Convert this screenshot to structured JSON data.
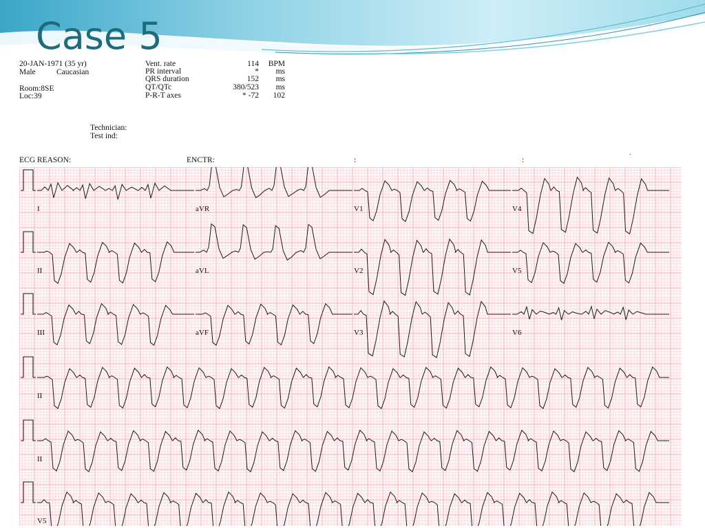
{
  "slide": {
    "title": "Case 5"
  },
  "patient": {
    "dob": "20-JAN-1971 (35 yr)",
    "sex": "Male",
    "race": "Caucasian",
    "room": "Room:8SE",
    "loc": "Loc:39"
  },
  "measurements": [
    {
      "label": "Vent. rate",
      "value": "114",
      "unit": "BPM"
    },
    {
      "label": "PR interval",
      "value": "*",
      "unit": "ms"
    },
    {
      "label": "QRS duration",
      "value": "152",
      "unit": "ms"
    },
    {
      "label": "QT/QTc",
      "value": "380/523",
      "unit": "ms"
    },
    {
      "label": "P-R-T axes",
      "value": "*   -72",
      "unit": "102"
    }
  ],
  "technician": {
    "label": "Technician:",
    "test_label": "Test ind:"
  },
  "reason_bar": {
    "reason": "ECG REASON:",
    "encounter": "ENCTR:",
    "colon1": ":",
    "colon2": ":",
    "dot": "."
  },
  "ecg": {
    "grid_color_minor": "#f7cfd6",
    "grid_color_major": "#ef9fae",
    "trace_color": "#1a1a1a",
    "rows": [
      [
        "I",
        "aVR",
        "V1",
        "V4"
      ],
      [
        "II",
        "aVL",
        "V2",
        "V5"
      ],
      [
        "III",
        "aVF",
        "V3",
        "V6"
      ],
      [
        "II"
      ],
      [
        "II"
      ],
      [
        "V5"
      ]
    ]
  }
}
